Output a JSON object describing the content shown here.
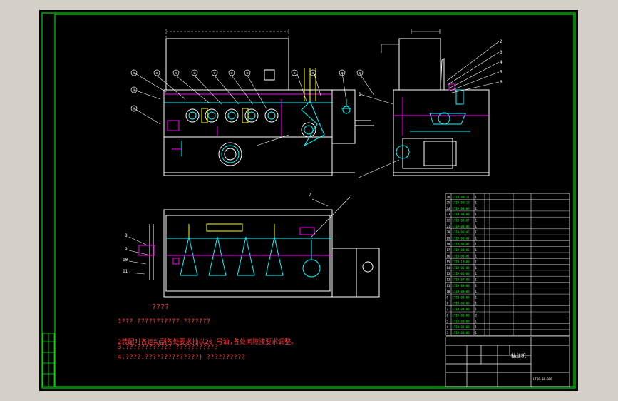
{
  "notes": {
    "heading": "????",
    "line1": "1???.??????????? ???????",
    "line2": "2装配时各运动副各处要求抽以20 号油,各处间隙按要求调整。",
    "line3": "3.???????????? ???????????",
    "line4": "4.????.??????????????)  ??????????"
  },
  "front_balloons": [
    "①",
    "⑫",
    "⑪",
    "⑩",
    "⑨",
    "⑧",
    "⑦",
    "⑥",
    "⑤",
    "④",
    "③",
    "②",
    "①",
    "⑬"
  ],
  "side_callouts": [
    "1",
    "2",
    "3",
    "4",
    "5",
    "6"
  ],
  "plan_callouts": [
    "7",
    "8",
    "9",
    "10",
    "11"
  ],
  "parts_list": [
    [
      "26",
      "LT19-00-11",
      "1",
      "",
      "",
      ""
    ],
    [
      "25",
      "LT19-00-10",
      "1",
      "",
      "",
      ""
    ],
    [
      "24",
      "LT19-00-09",
      "1",
      "",
      "",
      ""
    ],
    [
      "23",
      "LT19-00-08",
      "1",
      "",
      "",
      ""
    ],
    [
      "22",
      "LT19-00-07",
      "1",
      "",
      "",
      ""
    ],
    [
      "21",
      "LT19-00-06",
      "1",
      "",
      "",
      ""
    ],
    [
      "20",
      "LT19-00-05",
      "1",
      "",
      "",
      ""
    ],
    [
      "19",
      "LT19-00-04",
      "1",
      "",
      "",
      ""
    ],
    [
      "18",
      "LT19-00-03",
      "1",
      "",
      "",
      ""
    ],
    [
      "17",
      "LT19-00-02",
      "1",
      "",
      "",
      ""
    ],
    [
      "16",
      "LT19-00-01",
      "1",
      "",
      "",
      ""
    ],
    [
      "15",
      "LT19-10-00",
      "1",
      "",
      "",
      ""
    ],
    [
      "14",
      "LT19-06-00",
      "1",
      "",
      "",
      ""
    ],
    [
      "13",
      "LT19-05-00",
      "1",
      "",
      "",
      ""
    ],
    [
      "12",
      "LT19-07-00",
      "1",
      "",
      "",
      ""
    ],
    [
      "11",
      "LT19-08-00",
      "1",
      "",
      "",
      ""
    ],
    [
      "10",
      "LT19-09-00",
      "1",
      "",
      "",
      ""
    ],
    [
      "9",
      "LT19-03-00",
      "1",
      "",
      "",
      ""
    ],
    [
      "8",
      "LT19-01-00",
      "1",
      "",
      "",
      ""
    ],
    [
      "7",
      "LT19-04-00",
      "1",
      "",
      "",
      ""
    ],
    [
      "6",
      "LT19-02-00",
      "2",
      "",
      "",
      ""
    ],
    [
      "5",
      "LT19-03-00",
      "1",
      "",
      "",
      ""
    ],
    [
      "4",
      "LT19-02-00",
      "1",
      "",
      "",
      ""
    ],
    [
      "3",
      "LT19-01-00",
      "1",
      "",
      "",
      ""
    ]
  ],
  "title_block": {
    "name": "抽丝机",
    "unit": "",
    "drawing_no": "LT19-00-000",
    "left_strip": [
      "",
      "",
      "",
      ""
    ]
  },
  "colors": {
    "frame": "#00ff00",
    "outline": "#ffffff",
    "cyan": "#00ffff",
    "magenta": "#ff00ff",
    "yellow": "#ffff00",
    "red": "#ff3d3d"
  }
}
